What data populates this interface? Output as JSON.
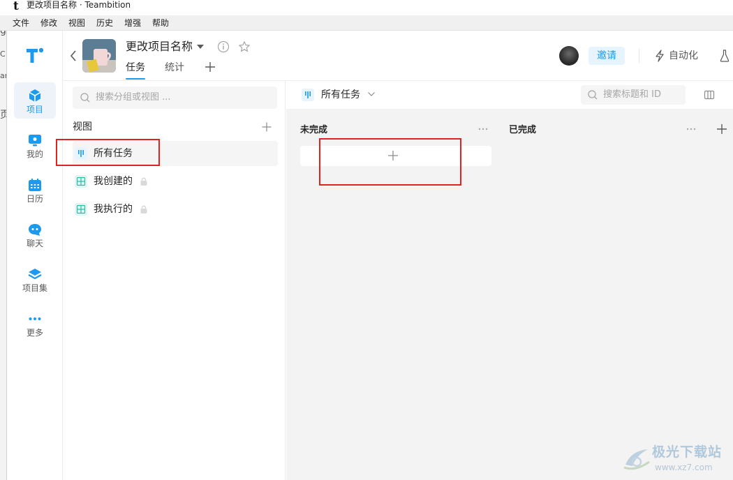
{
  "window": {
    "logo_glyph": "t",
    "title": "更改项目名称 · Teambition"
  },
  "menubar": {
    "items": [
      "文件",
      "修改",
      "视图",
      "历史",
      "增强",
      "帮助"
    ]
  },
  "background_strip": {
    "fragments": [
      "g",
      "C",
      "ar",
      "页"
    ]
  },
  "nav": {
    "items": [
      {
        "label": "项目",
        "icon": "project-cube-icon",
        "active": true
      },
      {
        "label": "我的",
        "icon": "monitor-icon",
        "active": false
      },
      {
        "label": "日历",
        "icon": "calendar-icon",
        "active": false
      },
      {
        "label": "聊天",
        "icon": "chat-icon",
        "active": false
      },
      {
        "label": "项目集",
        "icon": "layers-icon",
        "active": false
      },
      {
        "label": "更多",
        "icon": "more-dots-icon",
        "active": false
      }
    ]
  },
  "project": {
    "name": "更改项目名称",
    "tabs": [
      {
        "label": "任务",
        "active": true
      },
      {
        "label": "统计",
        "active": false
      }
    ]
  },
  "header_actions": {
    "invite_label": "邀请",
    "automation_label": "自动化"
  },
  "views_panel": {
    "search_placeholder": "搜索分组或视图 ...",
    "heading": "视图",
    "views": [
      {
        "label": "所有任务",
        "icon": "board-view-icon",
        "locked": false,
        "active": true
      },
      {
        "label": "我创建的",
        "icon": "table-view-icon",
        "locked": true,
        "active": false
      },
      {
        "label": "我执行的",
        "icon": "table-view-icon",
        "locked": true,
        "active": false
      }
    ]
  },
  "board": {
    "current_view": "所有任务",
    "search_placeholder": "搜索标题和 ID",
    "columns": [
      {
        "title": "未完成"
      },
      {
        "title": "已完成"
      }
    ]
  },
  "watermark": {
    "name": "极光下载站",
    "url": "www.xz7.com"
  },
  "colors": {
    "accent": "#1b9aee",
    "annotation": "#e02222",
    "board_bg": "#f3f3f3"
  }
}
